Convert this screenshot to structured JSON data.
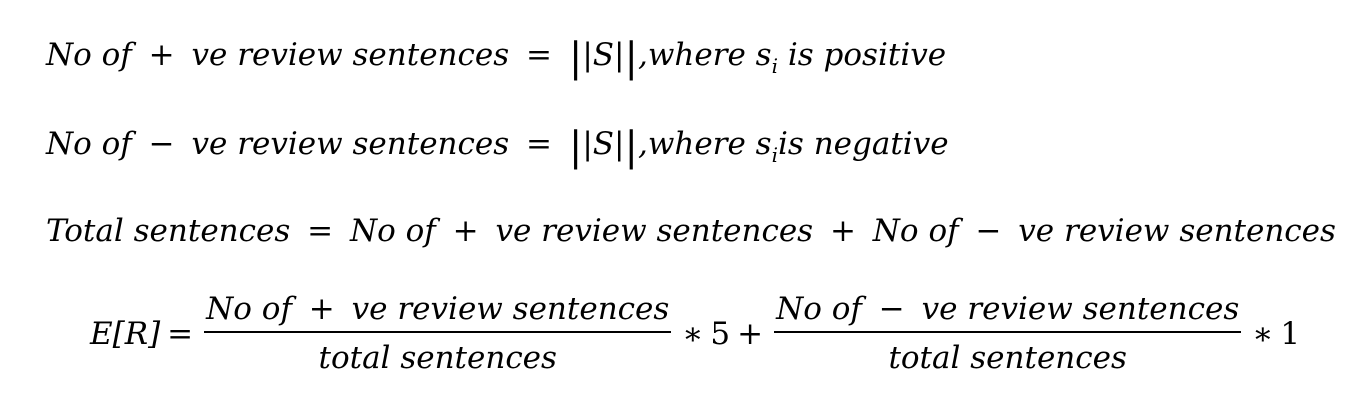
{
  "equations": {
    "eq1": {
      "lhs_a": "No of",
      "op_plus": "+",
      "lhs_b": "ve review sentences",
      "eq": "=",
      "norm": "S",
      "where": ",where s",
      "sub": "i",
      "tail": " is positive"
    },
    "eq2": {
      "lhs_a": "No of",
      "op_minus": "−",
      "lhs_b": "ve review sentences",
      "eq": "=",
      "norm": "S",
      "where": ",where s",
      "sub": "i",
      "tail": "is negative"
    },
    "eq3": {
      "lhs": "Total sentences",
      "eq": "=",
      "term1_a": "No of",
      "plus1": "+",
      "term1_b": "ve review sentences",
      "plus2": "+",
      "term2_a": "No of",
      "minus": "−",
      "term2_b": "ve review sentences"
    },
    "eq4": {
      "lhs": "E[R]",
      "eq": "=",
      "frac1_num_a": "No of",
      "frac1_plus": "+",
      "frac1_num_b": "ve review sentences",
      "frac1_den": "total sentences",
      "times1": "∗",
      "weight1": "5",
      "plus": "+",
      "frac2_num_a": "No of",
      "frac2_minus": "−",
      "frac2_num_b": "ve review sentences",
      "frac2_den": "total sentences",
      "times2": "∗",
      "weight2": "1"
    }
  }
}
